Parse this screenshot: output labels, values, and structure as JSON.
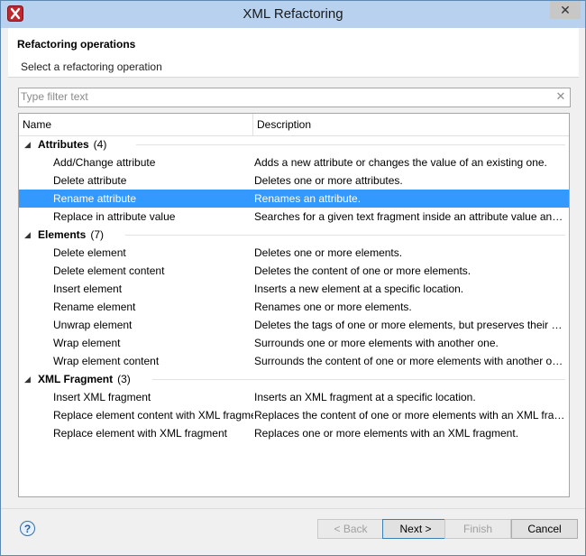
{
  "window": {
    "title": "XML Refactoring",
    "close_label": "✕"
  },
  "header": {
    "title": "Refactoring operations",
    "subtitle": "Select a refactoring operation"
  },
  "filter": {
    "placeholder": "Type filter text",
    "value": "",
    "clear_label": "✕"
  },
  "columns": {
    "name": "Name",
    "description": "Description"
  },
  "groups": [
    {
      "label": "Attributes",
      "count": "(4)",
      "items": [
        {
          "name": "Add/Change attribute",
          "description": "Adds a new attribute or changes the value of an existing one."
        },
        {
          "name": "Delete attribute",
          "description": "Deletes one or more attributes."
        },
        {
          "name": "Rename attribute",
          "description": "Renames an attribute.",
          "selected": true
        },
        {
          "name": "Replace in attribute value",
          "description": "Searches for a given text fragment inside an attribute value and repl..."
        }
      ]
    },
    {
      "label": "Elements",
      "count": "(7)",
      "items": [
        {
          "name": "Delete element",
          "description": "Deletes one or more elements."
        },
        {
          "name": "Delete element content",
          "description": "Deletes the content of one or more elements."
        },
        {
          "name": "Insert element",
          "description": "Inserts a new element at a specific location."
        },
        {
          "name": "Rename element",
          "description": "Renames one or more elements."
        },
        {
          "name": "Unwrap element",
          "description": "Deletes the tags of one or more elements, but preserves their content."
        },
        {
          "name": "Wrap element",
          "description": "Surrounds one or more elements with another one."
        },
        {
          "name": "Wrap element content",
          "description": "Surrounds the content of one or more elements with another one."
        }
      ]
    },
    {
      "label": "XML Fragment",
      "count": "(3)",
      "items": [
        {
          "name": "Insert XML fragment",
          "description": "Inserts an XML fragment at a specific location."
        },
        {
          "name": "Replace element content with XML fragment",
          "description": "Replaces the content of one or more elements with an XML fragment."
        },
        {
          "name": "Replace element with XML fragment",
          "description": "Replaces one or more elements with an XML fragment."
        }
      ]
    }
  ],
  "buttons": {
    "help": "?",
    "back": "< Back",
    "next": "Next >",
    "finish": "Finish",
    "cancel": "Cancel"
  },
  "colors": {
    "titlebar": "#b7d1ee",
    "selection": "#3399ff"
  },
  "icons": {
    "app": "xml-refactoring-app-icon",
    "group_expanded": "triangle-down-icon"
  }
}
